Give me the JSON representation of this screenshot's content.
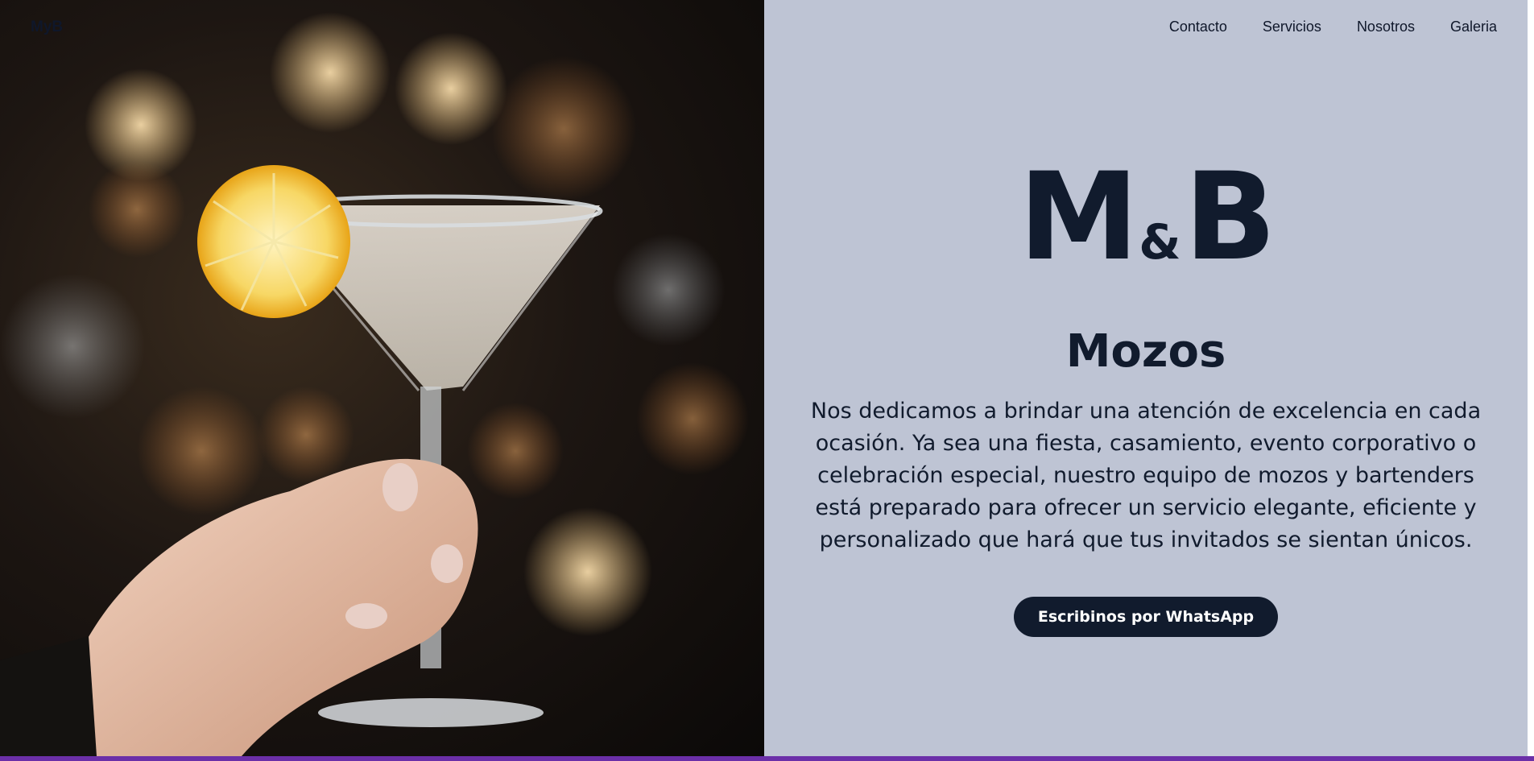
{
  "brand": {
    "name": "MyB"
  },
  "nav": {
    "items": [
      "Contacto",
      "Servicios",
      "Nosotros",
      "Galeria"
    ]
  },
  "hero": {
    "logo_left": "M",
    "logo_amp": "&",
    "logo_right": "B",
    "subtitle": "Mozos",
    "description": "Nos dedicamos a brindar una atención de excelencia en cada ocasión. Ya sea una fiesta, casamiento, evento corporativo o celebración especial, nuestro equipo de mozos y bartenders está preparado para ofrecer un servicio elegante, eficiente y personalizado que hará que tus invitados se sientan únicos.",
    "cta_label": "Escribinos por WhatsApp"
  },
  "colors": {
    "panel_bg": "#bec4d4",
    "text_dark": "#111b2d",
    "cta_bg": "#111b2d",
    "cta_text": "#ffffff",
    "bottom_accent": "#6b2fa8"
  },
  "photo": {
    "subject": "hand holding a martini glass with a lemon slice, bokeh background"
  }
}
